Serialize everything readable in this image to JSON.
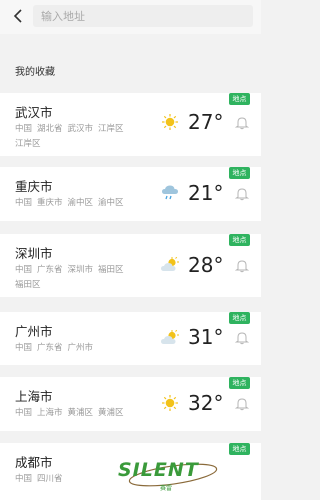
{
  "search": {
    "placeholder": "输入地址",
    "value": ""
  },
  "section_title": "我的收藏",
  "badge_label": "地点",
  "colors": {
    "badge": "#2fb35f",
    "sun": "#f2c21a",
    "cloud": "#cfe0ea",
    "rain": "#4aa3df"
  },
  "favorites": [
    {
      "city": "武汉市",
      "address": [
        "中国",
        "湖北省",
        "武汉市",
        "江岸区",
        "江岸区"
      ],
      "weather_icon": "sunny-icon",
      "temp": "27°"
    },
    {
      "city": "重庆市",
      "address": [
        "中国",
        "重庆市",
        "渝中区",
        "渝中区"
      ],
      "weather_icon": "rain-icon",
      "temp": "21°"
    },
    {
      "city": "深圳市",
      "address": [
        "中国",
        "广东省",
        "深圳市",
        "福田区",
        "福田区"
      ],
      "weather_icon": "partly-cloudy-icon",
      "temp": "28°"
    },
    {
      "city": "广州市",
      "address": [
        "中国",
        "广东省",
        "广州市"
      ],
      "weather_icon": "partly-cloudy-icon",
      "temp": "31°"
    },
    {
      "city": "上海市",
      "address": [
        "中国",
        "上海市",
        "黄浦区",
        "黄浦区"
      ],
      "weather_icon": "sunny-icon",
      "temp": "32°"
    },
    {
      "city": "成都市",
      "address": [
        "中国",
        "四川省"
      ],
      "weather_icon": "",
      "temp": ""
    }
  ],
  "watermark": {
    "text": "SILENT",
    "sub": "赛雷"
  }
}
